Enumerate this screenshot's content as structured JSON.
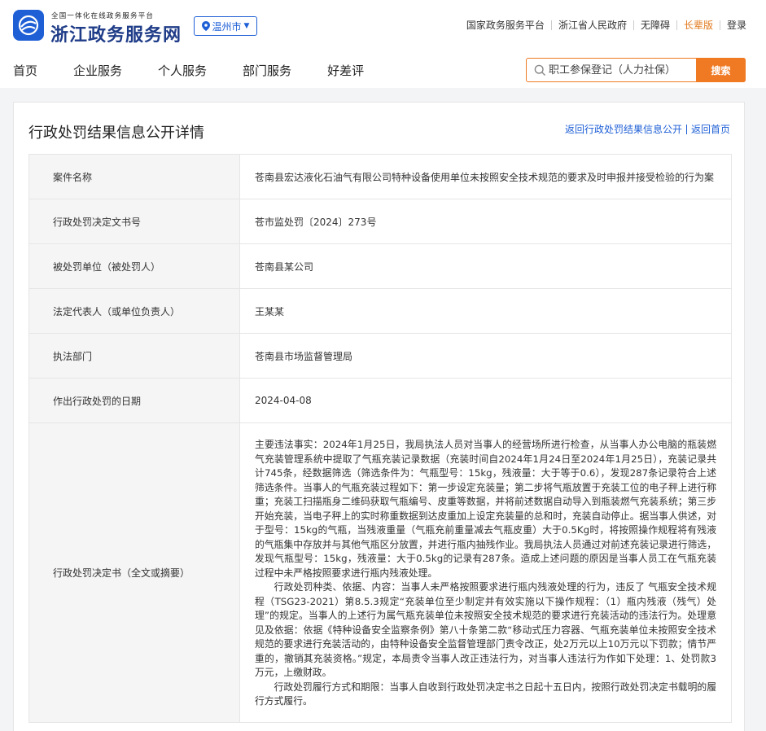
{
  "header": {
    "brand_sub": "全国一体化在线政务服务平台",
    "brand_title": "浙江政务服务网",
    "city": "温州市",
    "top_links": [
      "国家政务服务平台",
      "浙江省人民政府",
      "无障碍",
      "长辈版",
      "登录"
    ],
    "nav": [
      "首页",
      "企业服务",
      "个人服务",
      "部门服务",
      "好差评"
    ],
    "search_placeholder": "职工参保登记（人力社保）",
    "search_button": "搜索"
  },
  "page": {
    "title": "行政处罚结果信息公开详情",
    "back_link": "返回行政处罚结果信息公开",
    "home_link": "返回首页"
  },
  "details": [
    {
      "label": "案件名称",
      "value": "苍南县宏达液化石油气有限公司特种设备使用单位未按照安全技术规范的要求及时申报并接受检验的行为案"
    },
    {
      "label": "行政处罚决定文书号",
      "value": "苍市监处罚〔2024〕273号"
    },
    {
      "label": "被处罚单位（被处罚人）",
      "value": "苍南县某公司"
    },
    {
      "label": "法定代表人（或单位负责人）",
      "value": "王某某"
    },
    {
      "label": "执法部门",
      "value": "苍南县市场监督管理局"
    },
    {
      "label": "作出行政处罚的日期",
      "value": "2024-04-08"
    }
  ],
  "decision": {
    "label": "行政处罚决定书（全文或摘要）",
    "paragraphs": [
      "主要违法事实：2024年1月25日，我局执法人员对当事人的经营场所进行检查，从当事人办公电脑的瓶装燃气充装管理系统中提取了气瓶充装记录数据（充装时间自2024年1月24日至2024年1月25日），充装记录共计745条，经数据筛选（筛选条件为：气瓶型号：15kg，残液量：大于等于0.6），发现287条记录符合上述筛选条件。当事人的气瓶充装过程如下：第一步设定充装量；第二步将气瓶放置于充装工位的电子秤上进行称重；充装工扫描瓶身二维码获取气瓶编号、皮重等数据，并将前述数据自动导入到瓶装燃气充装系统；第三步开始充装，当电子秤上的实时称重数据到达皮重加上设定充装量的总和时，充装自动停止。据当事人供述，对于型号：15kg的气瓶，当残液重量（气瓶充前重量减去气瓶皮重）大于0.5Kg时，将按照操作规程将有残液的气瓶集中存放并与其他气瓶区分放置，并进行瓶内抽残作业。我局执法人员通过对前述充装记录进行筛选，发现气瓶型号：15kg，残液量：大于0.5kg的记录有287条。造成上述问题的原因是当事人员工在气瓶充装过程中未严格按照要求进行瓶内残液处理。",
      "行政处罚种类、依据、内容：当事人未严格按照要求进行瓶内残液处理的行为，违反了 气瓶安全技术规程（TSG23-2021）第8.5.3规定“充装单位至少制定并有效实施以下操作规程：（1）瓶内残液（残气）处理”的规定。当事人的上述行为属气瓶充装单位未按照安全技术规范的要求进行充装活动的违法行为。处理意见及依据：依据《特种设备安全监察条例》第八十条第二款“移动式压力容器、气瓶充装单位未按照安全技术规范的要求进行充装活动的，由特种设备安全监督管理部门责令改正，处2万元以上10万元以下罚款；情节严重的，撤销其充装资格。”规定，本局责令当事人改正违法行为，对当事人违法行为作如下处理：1、处罚款3万元，上缴财政。",
      "行政处罚履行方式和期限：当事人自收到行政处罚决定书之日起十五日内，按照行政处罚决定书载明的履行方式履行。"
    ]
  }
}
